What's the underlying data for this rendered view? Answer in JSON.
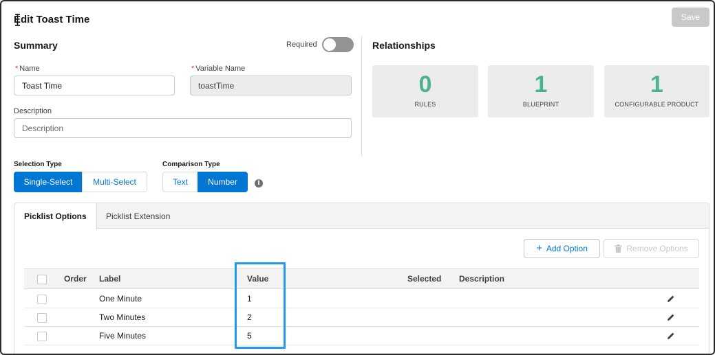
{
  "header": {
    "title": "Edit Toast Time",
    "save_label": "Save"
  },
  "summary": {
    "title": "Summary",
    "required_label": "Required",
    "required_on": false,
    "name_label": "Name",
    "name_value": "Toast Time",
    "variable_label": "Variable Name",
    "variable_value": "toastTime",
    "description_label": "Description",
    "description_placeholder": "Description"
  },
  "relationships": {
    "title": "Relationships",
    "cards": [
      {
        "count": "0",
        "label": "RULES"
      },
      {
        "count": "1",
        "label": "BLUEPRINT"
      },
      {
        "count": "1",
        "label": "CONFIGURABLE PRODUCT"
      }
    ]
  },
  "selection_type": {
    "label": "Selection Type",
    "options": [
      "Single-Select",
      "Multi-Select"
    ],
    "selected": "Single-Select"
  },
  "comparison_type": {
    "label": "Comparison Type",
    "options": [
      "Text",
      "Number"
    ],
    "selected": "Number",
    "info_icon": "info-icon"
  },
  "tabs": [
    {
      "label": "Picklist Options",
      "active": true
    },
    {
      "label": "Picklist Extension",
      "active": false
    }
  ],
  "toolbar": {
    "add_label": "Add Option",
    "add_icon": "plus-icon",
    "remove_label": "Remove Options",
    "remove_icon": "trash-icon"
  },
  "table": {
    "columns": [
      "Order",
      "Label",
      "Value",
      "Selected",
      "Description"
    ],
    "rows": [
      {
        "order": "",
        "label": "One Minute",
        "value": "1",
        "selected": "",
        "description": ""
      },
      {
        "order": "",
        "label": "Two Minutes",
        "value": "2",
        "selected": "",
        "description": ""
      },
      {
        "order": "",
        "label": "Five Minutes",
        "value": "5",
        "selected": "",
        "description": ""
      }
    ]
  },
  "colors": {
    "brand": "#0176d3",
    "count_green": "#4bb38e",
    "highlight": "#1d9bf0",
    "disabled": "#c9c9c9"
  }
}
